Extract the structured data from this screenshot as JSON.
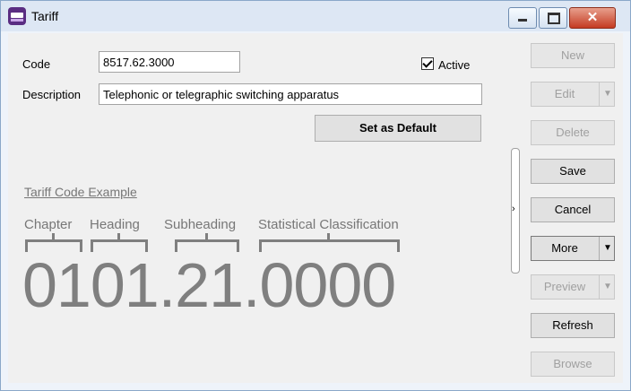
{
  "window": {
    "title": "Tariff",
    "controls": {
      "minimize": "minimize",
      "maximize": "maximize",
      "close": "✕"
    }
  },
  "form": {
    "code_label": "Code",
    "code_value": "8517.62.3000",
    "active_label": "Active",
    "active_checked": true,
    "description_label": "Description",
    "description_value": "Telephonic or telegraphic switching apparatus",
    "set_default_label": "Set as Default"
  },
  "example": {
    "title": "Tariff Code Example",
    "captions": [
      "Chapter",
      "Heading",
      "Subheading",
      "Statistical Classification"
    ],
    "code": "0101.21.0000"
  },
  "sidebar": {
    "buttons": [
      {
        "label": "New",
        "enabled": false
      },
      {
        "label": "Edit",
        "enabled": false,
        "dropdown": true
      },
      {
        "label": "Delete",
        "enabled": false
      },
      {
        "label": "Save",
        "enabled": true
      },
      {
        "label": "Cancel",
        "enabled": true
      },
      {
        "label": "More",
        "enabled": true,
        "dropdown": true
      },
      {
        "label": "Preview",
        "enabled": false,
        "dropdown": true
      },
      {
        "label": "Refresh",
        "enabled": true
      },
      {
        "label": "Browse",
        "enabled": false
      }
    ],
    "splitter_arrow": "›"
  }
}
